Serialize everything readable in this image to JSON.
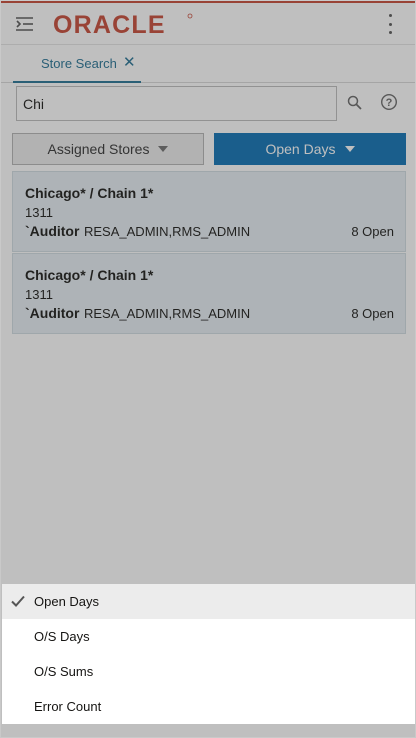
{
  "header": {
    "brand": "ORACLE",
    "brand_color": "#C74634",
    "nav_icon": "menu-expand-icon",
    "overflow_icon": "vertical-ellipsis-icon"
  },
  "tabs": [
    {
      "label": "Store Search",
      "close_icon": "close-icon",
      "active": true
    }
  ],
  "search": {
    "value": "Chi",
    "search_icon": "magnifier-icon",
    "help_icon": "help-circle-icon"
  },
  "filters": {
    "assigned_label": "Assigned Stores",
    "sort_label": "Open Days"
  },
  "results": [
    {
      "title": "Chicago* / Chain 1*",
      "code": "1311",
      "auditor": "`Auditor",
      "roles": "RESA_ADMIN,RMS_ADMIN",
      "open": "8 Open"
    },
    {
      "title": "Chicago* / Chain 1*",
      "code": "1311",
      "auditor": "`Auditor",
      "roles": "RESA_ADMIN,RMS_ADMIN",
      "open": "8 Open"
    }
  ],
  "sort_menu": {
    "options": [
      "Open Days",
      "O/S Days",
      "O/S Sums",
      "Error Count"
    ],
    "selected": "Open Days",
    "check_icon": "checkmark-icon"
  },
  "colors": {
    "accent": "#227093",
    "primary_button": "#0A6FB3",
    "card_background": "#E6EEF3"
  }
}
